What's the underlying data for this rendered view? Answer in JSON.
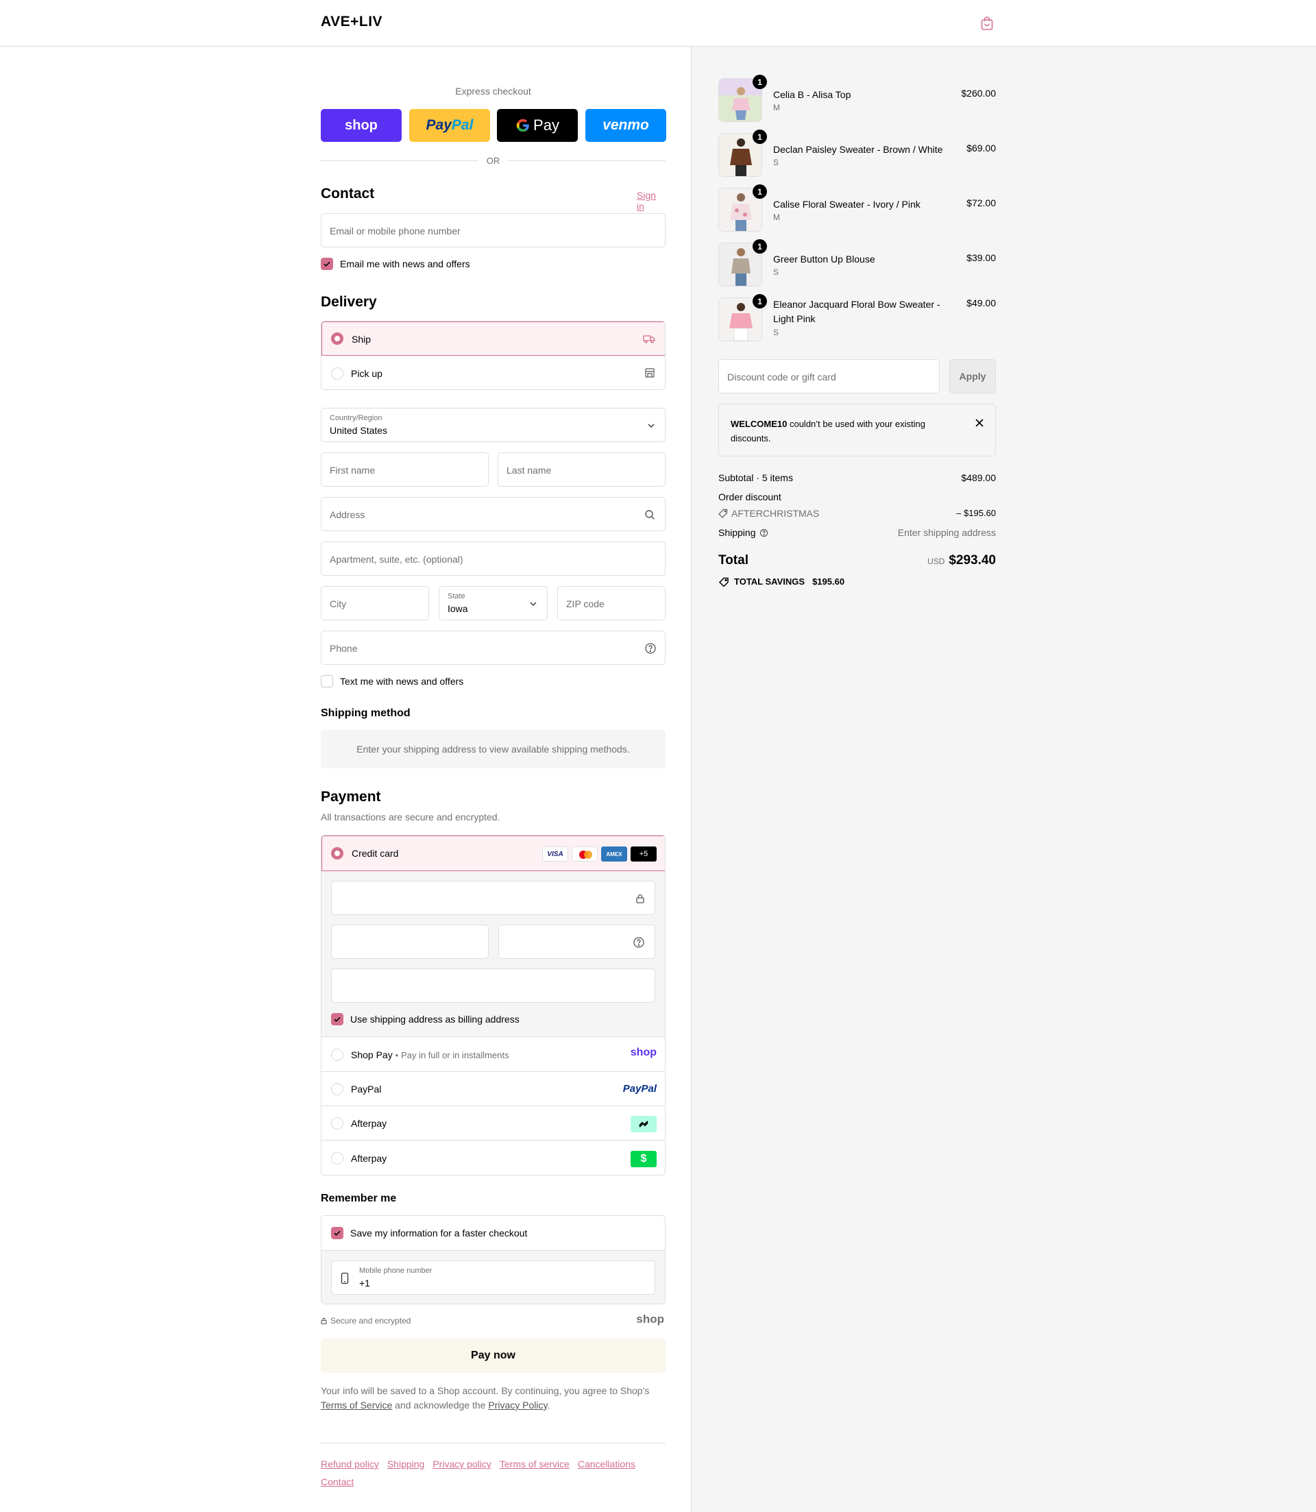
{
  "header": {
    "logo": "AVE+LIV",
    "cart_icon": "shopping-bag-icon",
    "brand_color": "#d46e8d"
  },
  "express": {
    "label": "Express checkout",
    "shop": "shop",
    "paypal_a": "Pay",
    "paypal_b": "Pal",
    "gpay": "Pay",
    "venmo": "venmo",
    "or": "OR"
  },
  "contact": {
    "title": "Contact",
    "sign_in": "Sign in",
    "email_placeholder": "Email or mobile phone number",
    "email_optin": "Email me with news and offers",
    "email_optin_checked": true
  },
  "delivery": {
    "title": "Delivery",
    "options": [
      {
        "label": "Ship",
        "selected": true,
        "icon": "truck-icon"
      },
      {
        "label": "Pick up",
        "selected": false,
        "icon": "store-icon"
      }
    ],
    "country_label": "Country/Region",
    "country_value": "United States",
    "first_name": "First name",
    "last_name": "Last name",
    "address": "Address",
    "apartment": "Apartment, suite, etc. (optional)",
    "city": "City",
    "state_label": "State",
    "state_value": "Iowa",
    "zip": "ZIP code",
    "phone": "Phone",
    "sms_optin": "Text me with news and offers",
    "sms_optin_checked": false
  },
  "shipping_method": {
    "title": "Shipping method",
    "notice": "Enter your shipping address to view available shipping methods."
  },
  "payment": {
    "title": "Payment",
    "subtitle": "All transactions are secure and encrypted.",
    "credit_card": "Credit card",
    "card_brands": [
      "VISA",
      "mastercard",
      "AMEX",
      "+5"
    ],
    "billing_same": "Use shipping address as billing address",
    "billing_same_checked": true,
    "methods": [
      {
        "label": "Shop Pay",
        "sub": "Pay in full or in installments",
        "logo": "shop"
      },
      {
        "label": "PayPal",
        "sub": "",
        "logo": "PayPal"
      },
      {
        "label": "Afterpay",
        "sub": "",
        "logo": "afterpay-icon"
      },
      {
        "label": "Afterpay",
        "sub": "",
        "logo": "cashapp-icon"
      }
    ]
  },
  "remember": {
    "title": "Remember me",
    "save_info": "Save my information for a faster checkout",
    "save_info_checked": true,
    "mobile_label": "Mobile phone number",
    "mobile_value": "+1"
  },
  "secure": {
    "text": "Secure and encrypted",
    "brand": "shop"
  },
  "pay_now": "Pay now",
  "legal": {
    "line1": "Your info will be saved to a Shop account. By continuing, you agree to Shop’s",
    "tos": "Terms of Service",
    "and_ack": "and acknowledge the",
    "privacy": "Privacy Policy",
    "dot": "."
  },
  "footer_links": [
    "Refund policy",
    "Shipping",
    "Privacy policy",
    "Terms of service",
    "Cancellations",
    "Contact"
  ],
  "order": {
    "items": [
      {
        "name": "Celia B - Alisa Top",
        "variant": "M",
        "price": "$260.00",
        "qty": "1"
      },
      {
        "name": "Declan Paisley Sweater - Brown / White",
        "variant": "S",
        "price": "$69.00",
        "qty": "1"
      },
      {
        "name": "Calise Floral Sweater - Ivory / Pink",
        "variant": "M",
        "price": "$72.00",
        "qty": "1"
      },
      {
        "name": "Greer Button Up Blouse",
        "variant": "S",
        "price": "$39.00",
        "qty": "1"
      },
      {
        "name": "Eleanor Jacquard Floral Bow Sweater - Light Pink",
        "variant": "S",
        "price": "$49.00",
        "qty": "1"
      }
    ],
    "discount_placeholder": "Discount code or gift card",
    "apply": "Apply",
    "error_code": "WELCOME10",
    "error_text": "couldn’t be used with your existing discounts.",
    "subtotal_label": "Subtotal · 5 items",
    "subtotal_value": "$489.00",
    "order_discount_label": "Order discount",
    "discount_code": "AFTERCHRISTMAS",
    "discount_value": "– $195.60",
    "shipping_label": "Shipping",
    "shipping_value": "Enter shipping address",
    "total_label": "Total",
    "currency": "USD",
    "total_value": "$293.40",
    "savings_label": "TOTAL SAVINGS",
    "savings_value": "$195.60"
  }
}
